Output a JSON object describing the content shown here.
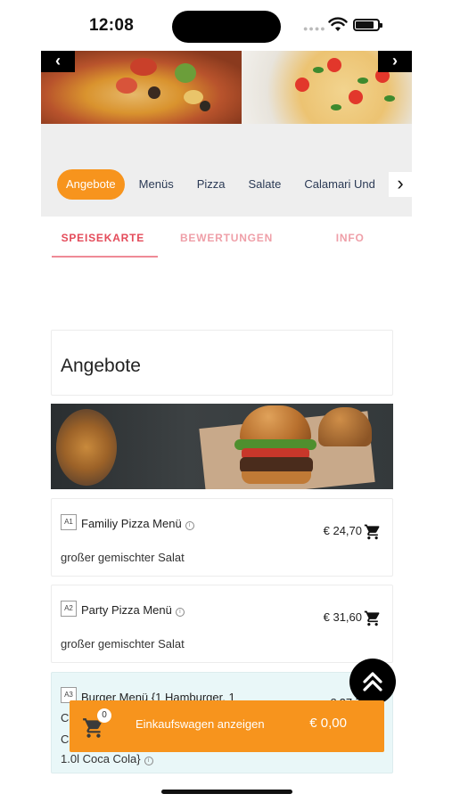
{
  "status_bar": {
    "time": "12:08"
  },
  "hero": {
    "prev_arrow": "‹",
    "next_arrow": "›"
  },
  "categories": {
    "items": [
      "Angebote",
      "Menüs",
      "Pizza",
      "Salate",
      "Calamari Und"
    ],
    "active_index": 0,
    "next_arrow": "›"
  },
  "tabs": [
    {
      "label": "SPEISEKARTE",
      "active": true
    },
    {
      "label": "BEWERTUNGEN",
      "active": false
    },
    {
      "label": "INFO",
      "active": false
    }
  ],
  "section": {
    "title": "Angebote"
  },
  "menu_items": [
    {
      "code": "A1",
      "name": "Familiy Pizza Menü",
      "description": "großer gemischter Salat",
      "price": "€ 24,70"
    },
    {
      "code": "A2",
      "name": "Party Pizza Menü",
      "description": "großer gemischter Salat",
      "price": "€ 31,60"
    },
    {
      "code": "A3",
      "name_line1": "Burger Menü {1 Hamburger, 1",
      "name_line2": "C",
      "name_line3": "C",
      "name_line4": "1.0l Coca Cola}",
      "price": "€ 27,7"
    }
  ],
  "cart": {
    "count": "0",
    "label": "Einkaufswagen anzeigen",
    "total": "€ 0,00"
  },
  "colors": {
    "accent": "#f7941d",
    "tab_active": "#e44b5a",
    "tab_inactive": "#ef9fa8",
    "highlight_row": "#e9f7f8"
  }
}
